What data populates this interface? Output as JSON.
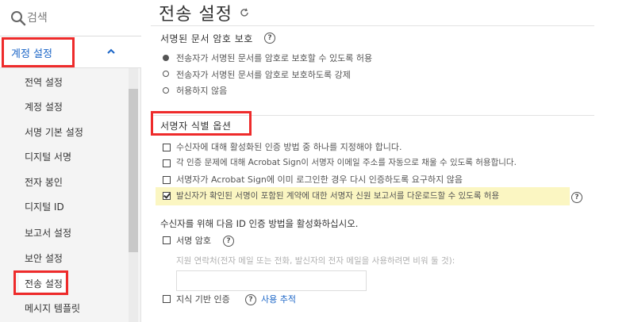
{
  "search": {
    "placeholder": "검색"
  },
  "sidebar": {
    "group_label": "계정 설정",
    "items": [
      {
        "label": "전역 설정"
      },
      {
        "label": "계정 설정"
      },
      {
        "label": "서명 기본 설정"
      },
      {
        "label": "디지털 서명"
      },
      {
        "label": "전자 봉인"
      },
      {
        "label": "디지털 ID"
      },
      {
        "label": "보고서 설정"
      },
      {
        "label": "보안 설정"
      },
      {
        "label": "전송 설정"
      },
      {
        "label": "메시지 템플릿"
      }
    ],
    "active_item": "전송 설정"
  },
  "main": {
    "title": "전송 설정",
    "password_section": {
      "label": "서명된 문서 암호 보호",
      "options": [
        {
          "text": "전송자가 서명된 문서를 암호로 보호할 수 있도록 허용",
          "selected": true
        },
        {
          "text": "전송자가 서명된 문서를 암호로 보호하도록 강제",
          "selected": false
        },
        {
          "text": "허용하지 않음",
          "selected": false
        }
      ]
    },
    "identity_section": {
      "label": "서명자 식별 옵션",
      "options": [
        {
          "text": "수신자에 대해 활성화된 인증 방법 중 하나를 지정해야 합니다.",
          "checked": false
        },
        {
          "text": "각 인증 문제에 대해 Acrobat Sign이 서명자 이메일 주소를 자동으로 채울 수 있도록 허용합니다.",
          "checked": false
        },
        {
          "text": "서명자가 Acrobat Sign에 이미 로그인한 경우 다시 인증하도록 요구하지 않음",
          "checked": false
        },
        {
          "text": "발신자가 확인된 서명이 포함된 계약에 대한 서명자 신원 보고서를 다운로드할 수 있도록 허용",
          "checked": true
        }
      ]
    },
    "auth_methods": {
      "heading": "수신자를 위해 다음 ID 인증 방법을 활성화하십시오.",
      "password_label": "서명 암호",
      "support_contact_hint": "지원 연락처(전자 메일 또는 전화, 발신자의 전자 메일을 사용하려면 비워 둘 것):",
      "support_contact_value": "",
      "kba_label": "지식 기반 인증",
      "usage_tracking_link": "사용 추적"
    }
  },
  "colors": {
    "accent": "#1c66c7",
    "annotation": "#ee2b2b",
    "highlight": "#fbf6c2"
  }
}
